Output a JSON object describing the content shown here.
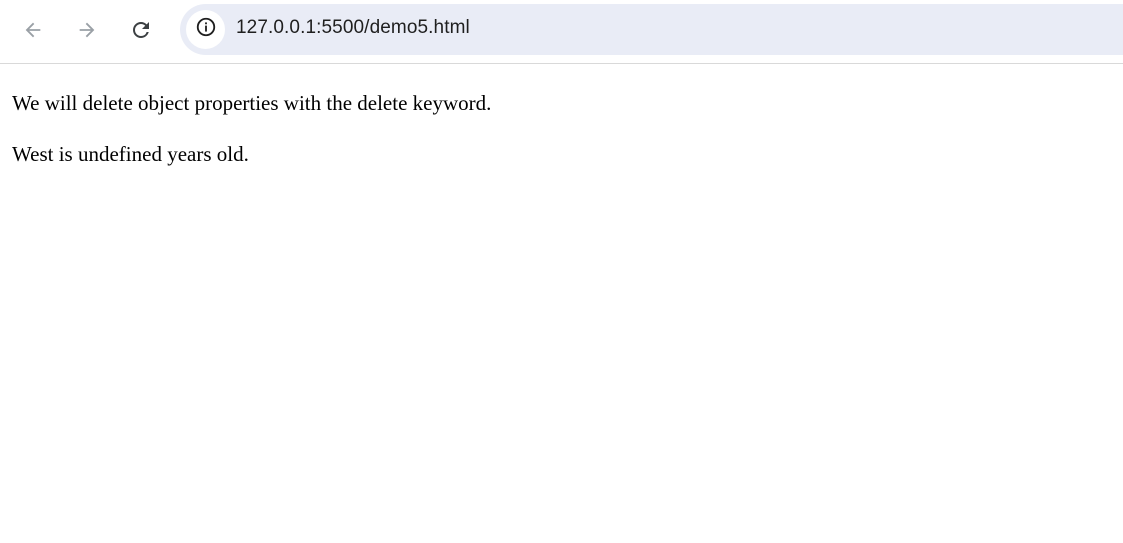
{
  "browser": {
    "address_bar": {
      "url": "127.0.0.1:5500/demo5.html",
      "site_info_icon": "info-icon"
    },
    "nav": {
      "back_icon": "arrow-left-icon",
      "forward_icon": "arrow-right-icon",
      "reload_icon": "reload-icon"
    },
    "colors": {
      "omnibox_bg": "#e9ecf6",
      "toolbar_border": "#d9d9d9",
      "icon_gray": "#5f6368"
    }
  },
  "page": {
    "paragraphs": [
      "We will delete object properties with the delete keyword.",
      "West is undefined years old."
    ]
  }
}
